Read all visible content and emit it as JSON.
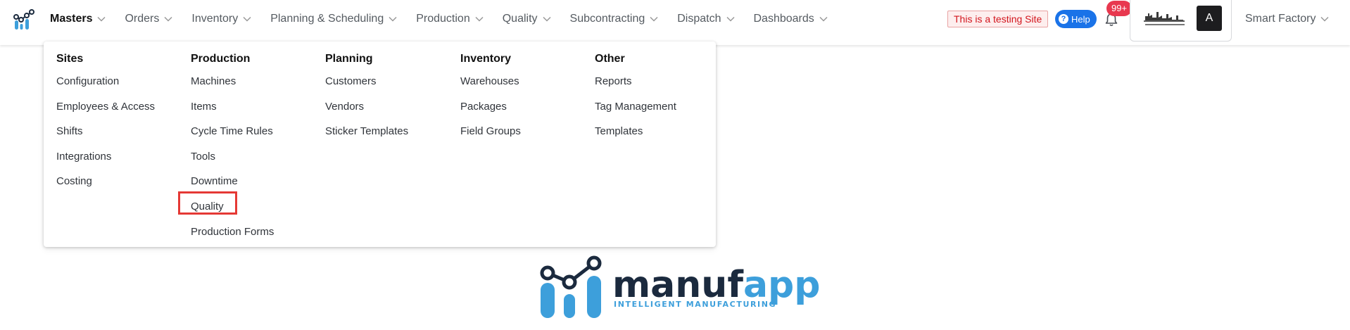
{
  "nav": {
    "items": [
      {
        "label": "Masters",
        "active": true
      },
      {
        "label": "Orders"
      },
      {
        "label": "Inventory"
      },
      {
        "label": "Planning & Scheduling"
      },
      {
        "label": "Production"
      },
      {
        "label": "Quality"
      },
      {
        "label": "Subcontracting"
      },
      {
        "label": "Dispatch"
      },
      {
        "label": "Dashboards"
      }
    ]
  },
  "header": {
    "testing_badge": "This is a testing Site",
    "help_label": "Help",
    "notification_count": "99+",
    "avatar_initial": "A",
    "factory_name": "Smart Factory"
  },
  "mega_menu": {
    "columns": [
      {
        "title": "Sites",
        "items": [
          "Configuration",
          "Employees & Access",
          "Shifts",
          "Integrations",
          "Costing"
        ]
      },
      {
        "title": "Production",
        "items": [
          "Machines",
          "Items",
          "Cycle Time Rules",
          "Tools",
          "Downtime",
          "Quality",
          "Production Forms"
        ]
      },
      {
        "title": "Planning",
        "items": [
          "Customers",
          "Vendors",
          "Sticker Templates"
        ]
      },
      {
        "title": "Inventory",
        "items": [
          "Warehouses",
          "Packages",
          "Field Groups"
        ]
      },
      {
        "title": "Other",
        "items": [
          "Reports",
          "Tag Management",
          "Templates"
        ]
      }
    ],
    "highlighted_item": "Quality"
  },
  "brand": {
    "name_dark": "manuf",
    "name_light": "app",
    "tagline": "INTELLIGENT MANUFACTURING"
  },
  "colors": {
    "brand_dark": "#1b2a3e",
    "brand_light": "#3d9fdb",
    "help_blue": "#1a73e8",
    "badge_red": "#e8384f",
    "highlight_red": "#e53935"
  },
  "icons": [
    "manufapp-logo-icon",
    "chevron-down-icon",
    "help-icon",
    "bell-icon",
    "manufacturing-logo-image"
  ]
}
